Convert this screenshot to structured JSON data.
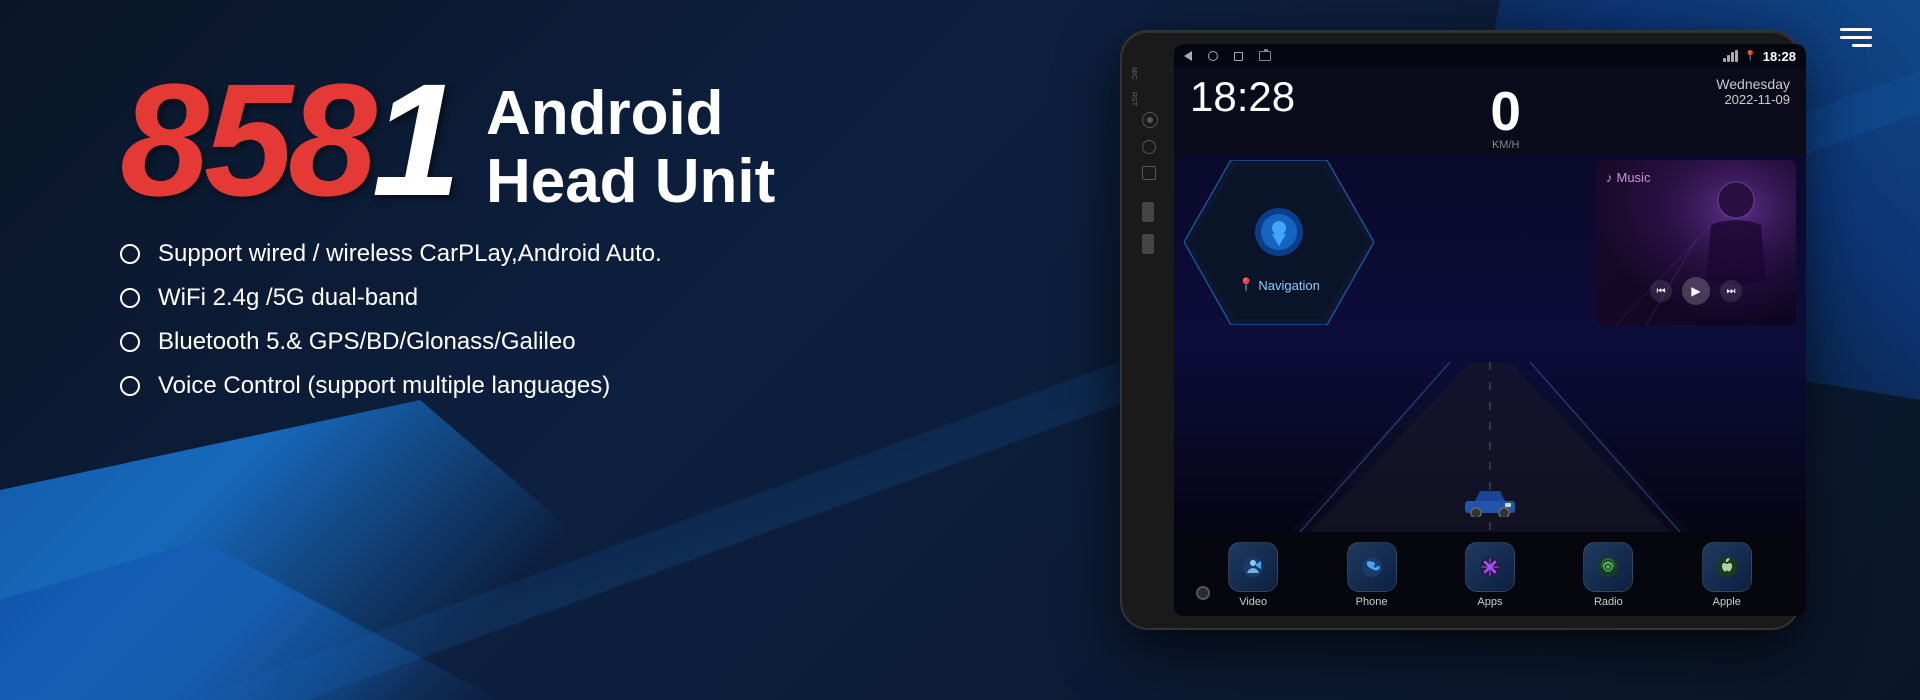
{
  "background": {
    "primary_color": "#0a1628",
    "accent_color": "#1565c0"
  },
  "header": {
    "menu_icon": "hamburger-menu-icon"
  },
  "product": {
    "model_number": "8581",
    "model_number_colored": "858",
    "model_number_white": "1",
    "title_line1": "Android",
    "title_line2": "Head Unit"
  },
  "features": [
    {
      "text": "Support wired / wireless CarPLay,Android Auto."
    },
    {
      "text": "WiFi 2.4g /5G dual-band"
    },
    {
      "text": "Bluetooth 5.& GPS/BD/Glonass/Galileo"
    },
    {
      "text": "Voice Control (support multiple languages)"
    }
  ],
  "device": {
    "status_bar": {
      "time": "18:28",
      "date_day": "Wednesday",
      "date_value": "2022-11-09"
    },
    "speed": {
      "value": "0",
      "unit": "KM/H"
    },
    "navigation_label": "Navigation",
    "music_label": "Music",
    "app_icons": [
      {
        "label": "Video",
        "icon": "🎬"
      },
      {
        "label": "Phone",
        "icon": "📞"
      },
      {
        "label": "Apps",
        "icon": "⊞"
      },
      {
        "label": "Radio",
        "icon": "📻"
      },
      {
        "label": "Apple",
        "icon": ""
      }
    ],
    "mic_label": "MIC",
    "rst_label": "RST"
  }
}
